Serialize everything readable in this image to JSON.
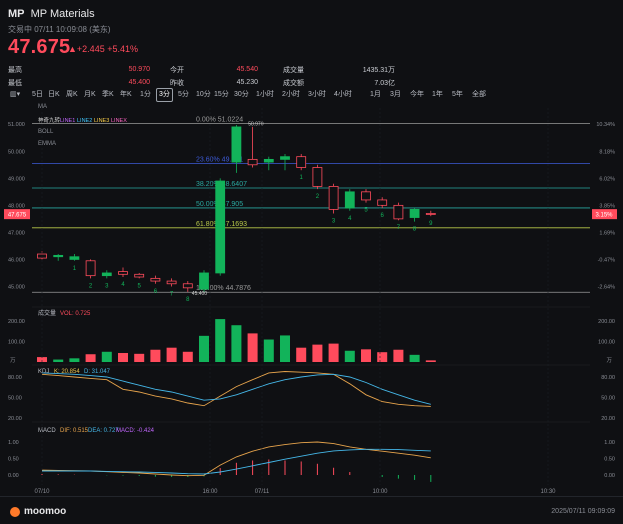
{
  "header": {
    "ticker": "MP",
    "name": "MP Materials",
    "status": "交易中 07/11 10:09:08 (美东)",
    "price": "47.675",
    "change": "+2.445",
    "change_pct": "+5.41%",
    "stats": [
      {
        "label": "最高",
        "value": "50.970",
        "label2": "今开",
        "value2": "45.540",
        "label3": "成交量",
        "value3": "1435.31万"
      },
      {
        "label": "最低",
        "value": "45.400",
        "label2": "昨收",
        "value2": "45.230",
        "label3": "成交额",
        "value3": "7.03亿"
      }
    ]
  },
  "toolbar": {
    "tabs": [
      "5日",
      "日K",
      "周K",
      "月K",
      "季K",
      "年K",
      "1分",
      "3分",
      "5分",
      "10分",
      "15分",
      "30分",
      "1小时",
      "2小时",
      "3小时",
      "4小时",
      "1月",
      "3月",
      "今年",
      "1年",
      "5年",
      "全部"
    ],
    "selected": "3分"
  },
  "indicators": {
    "ma": "MA",
    "lines": [
      "神奇九转",
      "LINE1",
      "LINE2",
      "LINE3",
      "LINEX"
    ],
    "boll": "BOLL",
    "ema": "EMMA",
    "vol_label": "成交量",
    "vol_value": "VOL: 0.725",
    "kdj_label": "KDJ",
    "kdj_k": "K: 20.854",
    "kdj_d": "D: 31.047",
    "macd_label": "MACD",
    "macd_dif": "DIF: 0.515",
    "macd_dea": "DEA: 0.727",
    "macd_val": "MACD: -0.424"
  },
  "fib": [
    {
      "label": "0.00% 51.0224",
      "value": 51.0224,
      "color": "#9a9a9a"
    },
    {
      "label": "23.60% 49.551",
      "value": 49.551,
      "color": "#3d5bd8"
    },
    {
      "label": "38.20% 48.6407",
      "value": 48.6407,
      "color": "#2aa9a0"
    },
    {
      "label": "50.00% 47.905",
      "value": 47.905,
      "color": "#2aa9a0"
    },
    {
      "label": "61.80% 47.1693",
      "value": 47.1693,
      "color": "#b9c94a"
    },
    {
      "label": "100.00% 44.7876",
      "value": 44.7876,
      "color": "#9a9a9a"
    }
  ],
  "axes": {
    "price_left": [
      "51.000",
      "50.000",
      "49.000",
      "48.000",
      "47.000",
      "46.000",
      "45.000"
    ],
    "pct_right": [
      "10.34%",
      "8.18%",
      "6.02%",
      "3.85%",
      "1.69%",
      "-0.47%",
      "-2.64%"
    ],
    "current_left": "47.675",
    "current_right": "3.15%",
    "vol_left": [
      "200.00",
      "100.00",
      "万"
    ],
    "vol_right": [
      "200.00",
      "100.00",
      "万"
    ],
    "kdj_left": [
      "80.00",
      "50.00",
      "20.00"
    ],
    "kdj_right": [
      "80.00",
      "50.00",
      "20.00"
    ],
    "macd_left": [
      "1.00",
      "0.50",
      "0.00"
    ],
    "macd_right": [
      "1.00",
      "0.50",
      "0.00"
    ],
    "time": [
      "07/10",
      "16:00",
      "07/11",
      "10:00",
      "10:30"
    ]
  },
  "annotations": {
    "high_label": "50.970",
    "low_label": "45.400"
  },
  "chart_data": {
    "type": "candlestick",
    "ylim": [
      44.5,
      51.6
    ],
    "candles": [
      {
        "o": 46.2,
        "h": 46.3,
        "l": 46.0,
        "c": 46.05,
        "n": ""
      },
      {
        "o": 46.1,
        "h": 46.2,
        "l": 45.95,
        "c": 46.15,
        "n": ""
      },
      {
        "o": 46.0,
        "h": 46.2,
        "l": 45.95,
        "c": 46.1,
        "n": "1"
      },
      {
        "o": 45.95,
        "h": 46.0,
        "l": 45.3,
        "c": 45.4,
        "n": "2"
      },
      {
        "o": 45.4,
        "h": 45.6,
        "l": 45.3,
        "c": 45.5,
        "n": "3"
      },
      {
        "o": 45.55,
        "h": 45.7,
        "l": 45.35,
        "c": 45.45,
        "n": "4"
      },
      {
        "o": 45.45,
        "h": 45.5,
        "l": 45.3,
        "c": 45.35,
        "n": "5"
      },
      {
        "o": 45.3,
        "h": 45.4,
        "l": 45.1,
        "c": 45.2,
        "n": "6"
      },
      {
        "o": 45.2,
        "h": 45.3,
        "l": 45.0,
        "c": 45.1,
        "n": "7"
      },
      {
        "o": 45.1,
        "h": 45.2,
        "l": 44.8,
        "c": 44.95,
        "n": "8"
      },
      {
        "o": 44.9,
        "h": 45.6,
        "l": 44.8,
        "c": 45.5,
        "n": ""
      },
      {
        "o": 45.5,
        "h": 49.0,
        "l": 45.4,
        "c": 48.9,
        "n": ""
      },
      {
        "o": 49.6,
        "h": 50.97,
        "l": 49.2,
        "c": 50.9,
        "n": ""
      },
      {
        "o": 49.7,
        "h": 50.9,
        "l": 49.4,
        "c": 49.5,
        "n": ""
      },
      {
        "o": 49.6,
        "h": 49.8,
        "l": 49.3,
        "c": 49.7,
        "n": ""
      },
      {
        "o": 49.7,
        "h": 49.9,
        "l": 49.3,
        "c": 49.8,
        "n": ""
      },
      {
        "o": 49.8,
        "h": 49.9,
        "l": 49.3,
        "c": 49.4,
        "n": "1"
      },
      {
        "o": 49.4,
        "h": 49.5,
        "l": 48.6,
        "c": 48.7,
        "n": "2"
      },
      {
        "o": 48.7,
        "h": 48.8,
        "l": 47.7,
        "c": 47.85,
        "n": "3"
      },
      {
        "o": 47.9,
        "h": 48.6,
        "l": 47.8,
        "c": 48.5,
        "n": "4"
      },
      {
        "o": 48.5,
        "h": 48.6,
        "l": 48.1,
        "c": 48.2,
        "n": "5"
      },
      {
        "o": 48.2,
        "h": 48.3,
        "l": 47.9,
        "c": 48.0,
        "n": "6"
      },
      {
        "o": 48.0,
        "h": 48.1,
        "l": 47.45,
        "c": 47.5,
        "n": "7"
      },
      {
        "o": 47.55,
        "h": 47.9,
        "l": 47.4,
        "c": 47.85,
        "n": "8"
      },
      {
        "o": 47.7,
        "h": 47.8,
        "l": 47.6,
        "c": 47.675,
        "n": "9"
      }
    ],
    "volume": [
      24,
      12,
      18,
      38,
      50,
      44,
      40,
      60,
      70,
      50,
      128,
      210,
      180,
      140,
      110,
      130,
      70,
      85,
      90,
      55,
      62,
      48,
      60,
      35,
      8
    ],
    "kdj": {
      "k": [
        84,
        82,
        80,
        78,
        76,
        62,
        58,
        52,
        48,
        42,
        38,
        52,
        66,
        76,
        86,
        88,
        87,
        86,
        84,
        70,
        54,
        44,
        40,
        38,
        37
      ],
      "d": [
        86,
        85,
        84,
        82,
        80,
        74,
        68,
        62,
        58,
        52,
        46,
        48,
        54,
        62,
        70,
        76,
        80,
        83,
        84,
        80,
        72,
        62,
        54,
        46,
        40
      ]
    },
    "macd": {
      "dif": [
        0.15,
        0.14,
        0.13,
        0.12,
        0.1,
        0.08,
        0.06,
        0.03,
        0.0,
        -0.02,
        -0.01,
        0.3,
        0.55,
        0.72,
        0.85,
        0.92,
        0.98,
        1.0,
        0.95,
        0.85,
        0.78,
        0.72,
        0.66,
        0.6,
        0.52
      ],
      "dea": [
        0.12,
        0.12,
        0.12,
        0.12,
        0.11,
        0.1,
        0.09,
        0.08,
        0.06,
        0.04,
        0.03,
        0.09,
        0.18,
        0.28,
        0.38,
        0.48,
        0.57,
        0.66,
        0.73,
        0.76,
        0.78,
        0.78,
        0.77,
        0.75,
        0.73
      ],
      "hist": [
        0.03,
        0.02,
        0.01,
        0.0,
        -0.01,
        -0.02,
        -0.03,
        -0.05,
        -0.06,
        -0.06,
        -0.04,
        0.21,
        0.37,
        0.44,
        0.47,
        0.44,
        0.41,
        0.34,
        0.22,
        0.09,
        0.0,
        -0.06,
        -0.11,
        -0.15,
        -0.21
      ]
    }
  }
}
